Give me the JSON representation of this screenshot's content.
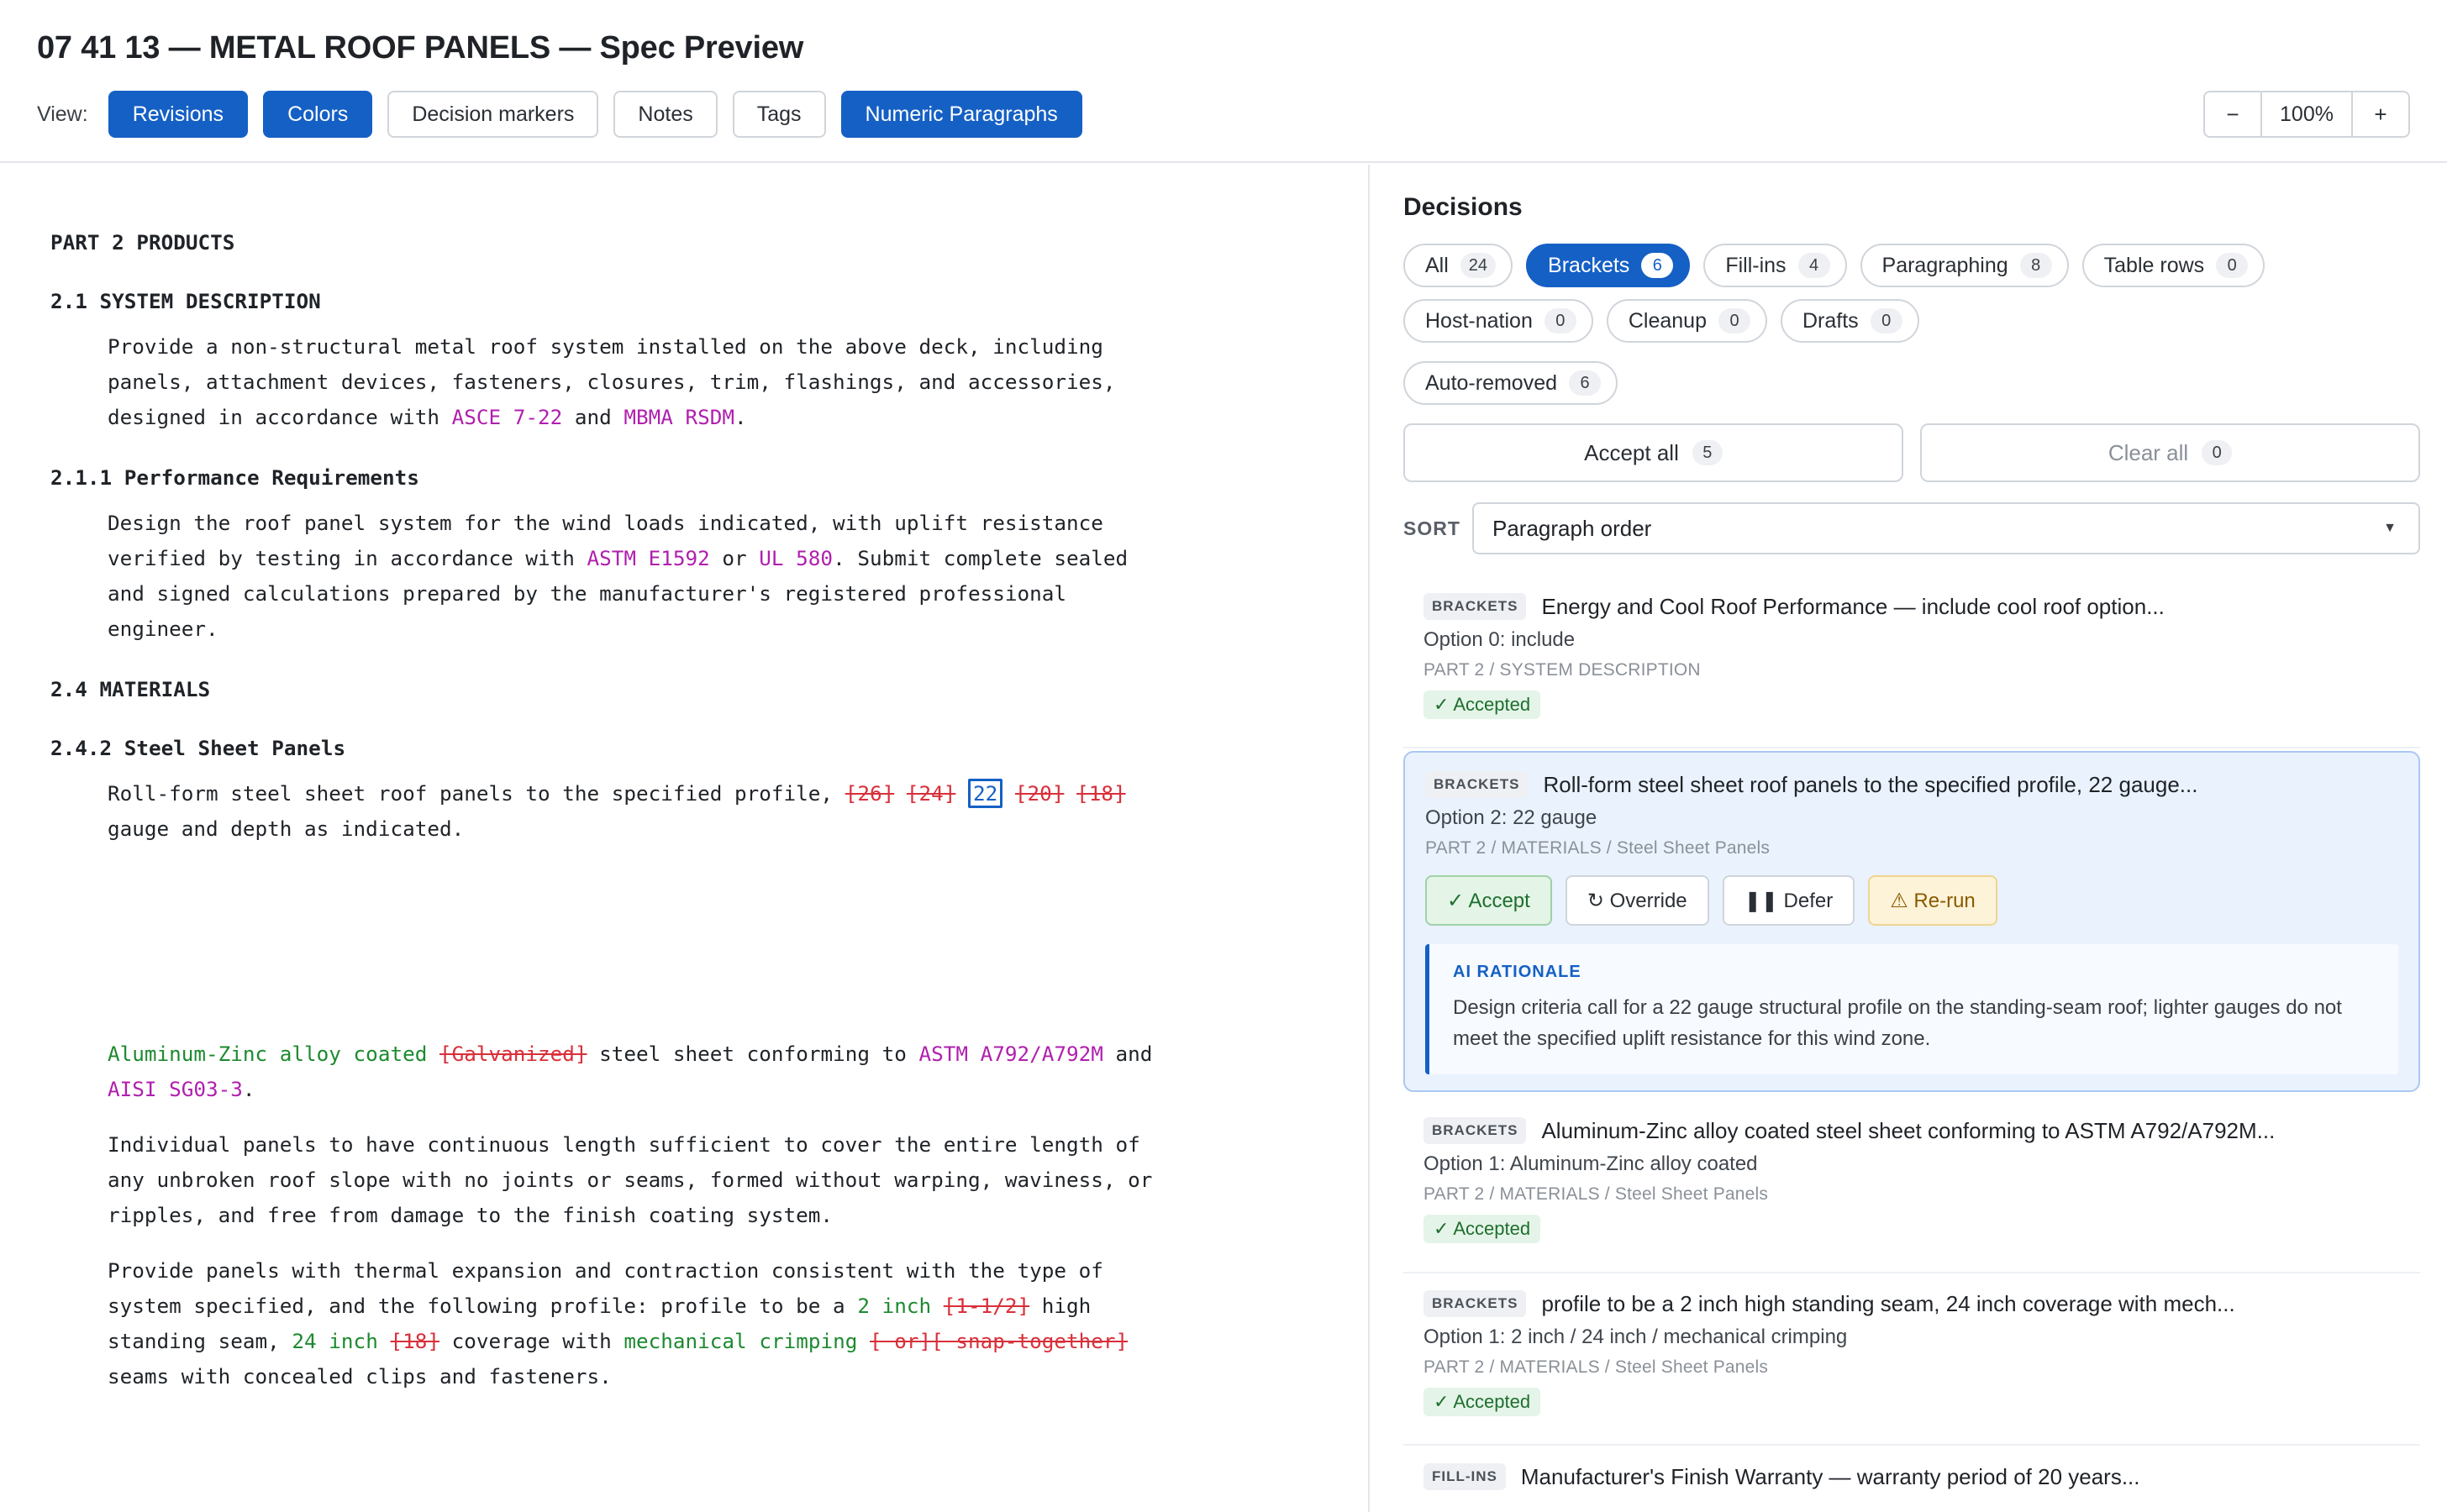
{
  "header": {
    "title": "07 41 13 — METAL ROOF PANELS — Spec Preview",
    "view_label": "View:",
    "view_buttons": [
      {
        "label": "Revisions",
        "active": true
      },
      {
        "label": "Colors",
        "active": true
      },
      {
        "label": "Decision markers",
        "active": false
      },
      {
        "label": "Notes",
        "active": false
      },
      {
        "label": "Tags",
        "active": false
      },
      {
        "label": "Numeric Paragraphs",
        "active": true
      }
    ],
    "zoom": {
      "minus": "−",
      "value": "100%",
      "plus": "+"
    }
  },
  "document": {
    "part_heading": "PART 2 PRODUCTS",
    "s21_heading": "2.1 SYSTEM DESCRIPTION",
    "s21_p1": {
      "line1": "Provide a non-structural metal roof system installed on the above deck, including",
      "line2": "panels, attachment devices, fasteners, closures, trim, flashings, and accessories,",
      "line3_a": "designed in accordance with ",
      "ref1": "ASCE 7-22",
      "line3_b": " and ",
      "ref2": "MBMA RSDM",
      "line3_c": "."
    },
    "s211_heading": "2.1.1 Performance Requirements",
    "s211_p1": {
      "line1": "Design the roof panel system for the wind loads indicated, with uplift resistance",
      "line2_a": "verified by testing in accordance with ",
      "ref1": "ASTM E1592",
      "line2_b": " or ",
      "ref2": "UL 580",
      "line2_c": ". Submit complete sealed",
      "line3": "and signed calculations prepared by the manufacturer's registered professional",
      "line4": "engineer."
    },
    "s24_heading": "2.4 MATERIALS",
    "s242_heading": "2.4.2 Steel Sheet Panels",
    "s242_p1": {
      "line1_a": "Roll-form steel sheet roof panels to the specified profile, ",
      "del1": "[26]",
      "del2": "[24]",
      "sel": "22",
      "del3": "[20]",
      "del4": "[18]",
      "line2": "gauge and depth as indicated."
    },
    "s242_p2": {
      "ins1": "Aluminum-Zinc alloy coated",
      "del1": "[Galvanized]",
      "line1_b": " steel sheet conforming to ",
      "ref1": "ASTM A792/A792M",
      "line1_c": " and",
      "ref2": "AISI SG03-3",
      "line2_b": "."
    },
    "s242_p3": {
      "line1": "Individual panels to have continuous length sufficient to cover the entire length of",
      "line2": "any unbroken roof slope with no joints or seams, formed without warping, waviness, or",
      "line3": "ripples, and free from damage to the finish coating system."
    },
    "s242_p4": {
      "line1": "Provide panels with thermal expansion and contraction consistent with the type of",
      "line2_a": "system specified, and the following profile: profile to be a ",
      "ins1": "2 inch",
      "del1": "[1-1/2]",
      "line2_b": " high",
      "line3_a": "standing seam, ",
      "ins2": "24 inch",
      "del2": "[18]",
      "line3_b": " coverage with ",
      "ins3": "mechanical crimping",
      "del3": "[ or][ snap-together]",
      "line4": "seams with concealed clips and fasteners."
    }
  },
  "decisions": {
    "title": "Decisions",
    "filters_row1": [
      {
        "label": "All",
        "count": "24",
        "active": false
      },
      {
        "label": "Brackets",
        "count": "6",
        "active": true
      },
      {
        "label": "Fill-ins",
        "count": "4",
        "active": false
      },
      {
        "label": "Paragraphing",
        "count": "8",
        "active": false
      },
      {
        "label": "Table rows",
        "count": "0",
        "active": false
      }
    ],
    "filters_row2": [
      {
        "label": "Host-nation",
        "count": "0",
        "active": false
      },
      {
        "label": "Cleanup",
        "count": "0",
        "active": false
      },
      {
        "label": "Drafts",
        "count": "0",
        "active": false
      }
    ],
    "filters_row3": [
      {
        "label": "Auto-removed",
        "count": "6",
        "active": false
      }
    ],
    "accept_all": {
      "label": "Accept all",
      "count": "5"
    },
    "clear_all": {
      "label": "Clear all",
      "count": "0"
    },
    "sort": {
      "label": "SORT",
      "value": "Paragraph order",
      "caret": "▼"
    },
    "cards": [
      {
        "tag": "BRACKETS",
        "title": "Energy and Cool Roof Performance — include cool roof option...",
        "option": "Option 0: include",
        "path": "PART 2 / SYSTEM DESCRIPTION",
        "status": "✓ Accepted"
      },
      {
        "tag": "BRACKETS",
        "title": "Roll-form steel sheet roof panels to the specified profile, 22 gauge...",
        "option": "Option 2: 22 gauge",
        "path": "PART 2 / MATERIALS / Steel Sheet Panels",
        "actions": {
          "accept": "✓ Accept",
          "override": "↻ Override",
          "defer": "❚❚ Defer",
          "rerun": "⚠ Re-run"
        },
        "rationale_label": "AI RATIONALE",
        "rationale_text": "Design criteria call for a 22 gauge structural profile on the standing-seam roof; lighter gauges do not meet the specified uplift resistance for this wind zone."
      },
      {
        "tag": "BRACKETS",
        "title": "Aluminum-Zinc alloy coated steel sheet conforming to ASTM A792/A792M...",
        "option": "Option 1: Aluminum-Zinc alloy coated",
        "path": "PART 2 / MATERIALS / Steel Sheet Panels",
        "status": "✓ Accepted"
      },
      {
        "tag": "BRACKETS",
        "title": "profile to be a 2 inch high standing seam, 24 inch coverage with mech...",
        "option": "Option 1: 2 inch / 24 inch / mechanical crimping",
        "path": "PART 2 / MATERIALS / Steel Sheet Panels",
        "status": "✓ Accepted"
      },
      {
        "tag": "FILL-INS",
        "title": "Manufacturer's Finish Warranty — warranty period of 20 years..."
      }
    ]
  },
  "colors": {
    "primary": "#1560c5",
    "reference": "#b01fae",
    "insertion": "#1d8a2f",
    "deletion": "#d8303a",
    "accepted_bg": "#e5f4e8"
  }
}
